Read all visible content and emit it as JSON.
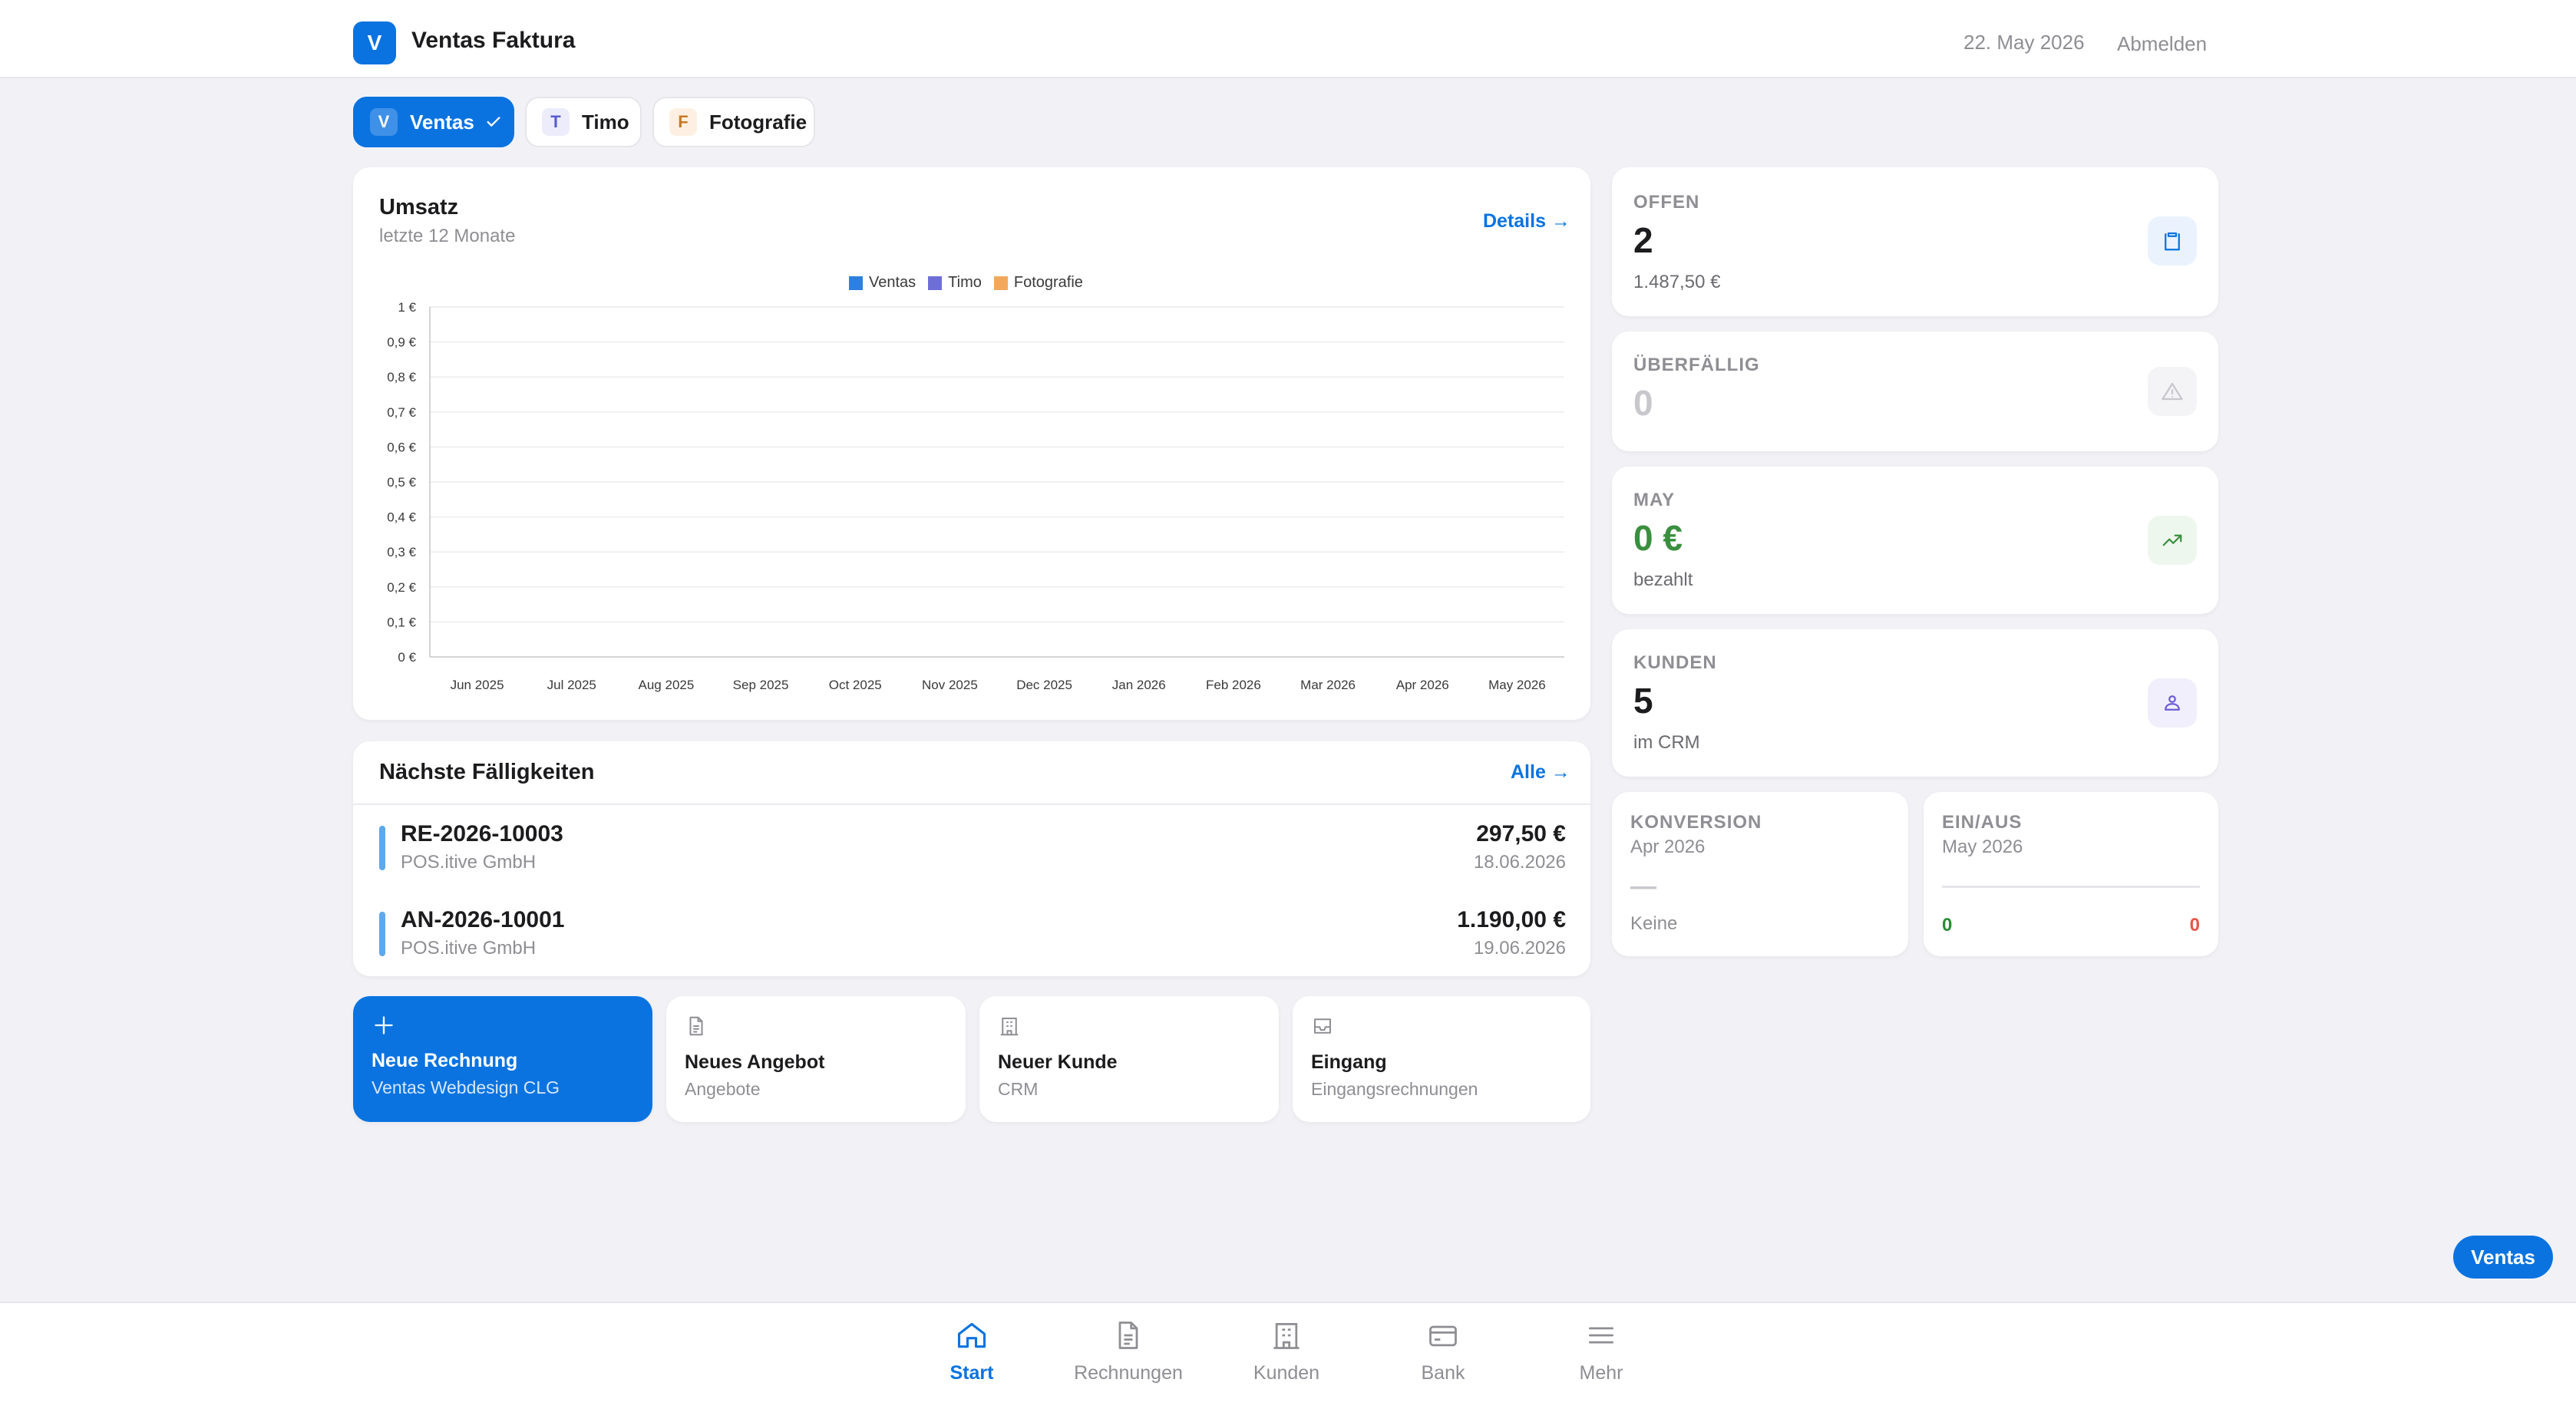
{
  "app": {
    "logo_letter": "V",
    "title": "Ventas Faktura",
    "date": "22. May 2026",
    "logout": "Abmelden"
  },
  "companies": [
    {
      "letter": "V",
      "name": "Ventas",
      "active": true
    },
    {
      "letter": "T",
      "name": "Timo",
      "active": false
    },
    {
      "letter": "F",
      "name": "Fotografie",
      "active": false
    }
  ],
  "revenue": {
    "title": "Umsatz",
    "subtitle": "letzte 12 Monate",
    "details_link": "Details →"
  },
  "chart_data": {
    "type": "bar",
    "categories": [
      "Jun 2025",
      "Jul 2025",
      "Aug 2025",
      "Sep 2025",
      "Oct 2025",
      "Nov 2025",
      "Dec 2025",
      "Jan 2026",
      "Feb 2026",
      "Mar 2026",
      "Apr 2026",
      "May 2026"
    ],
    "series": [
      {
        "name": "Ventas",
        "color": "#2f7fe0",
        "values": [
          0,
          0,
          0,
          0,
          0,
          0,
          0,
          0,
          0,
          0,
          0,
          0
        ]
      },
      {
        "name": "Timo",
        "color": "#6e6fd6",
        "values": [
          0,
          0,
          0,
          0,
          0,
          0,
          0,
          0,
          0,
          0,
          0,
          0
        ]
      },
      {
        "name": "Fotografie",
        "color": "#f2a85a",
        "values": [
          0,
          0,
          0,
          0,
          0,
          0,
          0,
          0,
          0,
          0,
          0,
          0
        ]
      }
    ],
    "yticks": [
      "0 €",
      "0,1 €",
      "0,2 €",
      "0,3 €",
      "0,4 €",
      "0,5 €",
      "0,6 €",
      "0,7 €",
      "0,8 €",
      "0,9 €",
      "1 €"
    ],
    "ylim": [
      0,
      1
    ],
    "grid": true,
    "legend": "top-center"
  },
  "due": {
    "title": "Nächste Fälligkeiten",
    "all_link": "Alle →",
    "items": [
      {
        "number": "RE-2026-10003",
        "customer": "POS.itive GmbH",
        "amount": "297,50 €",
        "date": "18.06.2026"
      },
      {
        "number": "AN-2026-10001",
        "customer": "POS.itive GmbH",
        "amount": "1.190,00 €",
        "date": "19.06.2026"
      }
    ]
  },
  "stats": {
    "open": {
      "label": "OFFEN",
      "value": "2",
      "sub": "1.487,50 €",
      "icon": "clipboard-icon",
      "color": "#0a73e0"
    },
    "overdue": {
      "label": "ÜBERFÄLLIG",
      "value": "0",
      "icon": "warning-icon",
      "color": "#c7c7cc"
    },
    "month": {
      "label": "MAY",
      "value": "0 €",
      "sub": "bezahlt",
      "icon": "trend-up-icon",
      "color": "#3a8f3e"
    },
    "customers": {
      "label": "KUNDEN",
      "value": "5",
      "sub": "im CRM",
      "icon": "people-icon",
      "color": "#6e5cd6"
    },
    "conversion": {
      "label": "KONVERSION",
      "period": "Apr 2026",
      "value": "—",
      "sub": "Keine"
    },
    "inout": {
      "label": "EIN/AUS",
      "period": "May 2026",
      "in": "0",
      "out": "0",
      "in_color": "#2e8b3a",
      "out_color": "#e2574c"
    }
  },
  "quick_actions": [
    {
      "title": "Neue Rechnung",
      "sub": "Ventas Webdesign CLG",
      "icon": "plus-icon"
    },
    {
      "title": "Neues Angebot",
      "sub": "Angebote",
      "icon": "document-icon"
    },
    {
      "title": "Neuer Kunde",
      "sub": "CRM",
      "icon": "building-icon"
    },
    {
      "title": "Eingang",
      "sub": "Eingangsrechnungen",
      "icon": "inbox-icon"
    }
  ],
  "nav": [
    {
      "label": "Start",
      "icon": "home-icon",
      "active": true
    },
    {
      "label": "Rechnungen",
      "icon": "document-icon",
      "active": false
    },
    {
      "label": "Kunden",
      "icon": "building-icon",
      "active": false
    },
    {
      "label": "Bank",
      "icon": "card-icon",
      "active": false
    },
    {
      "label": "Mehr",
      "icon": "menu-icon",
      "active": false
    }
  ],
  "fab_label": "Ventas"
}
